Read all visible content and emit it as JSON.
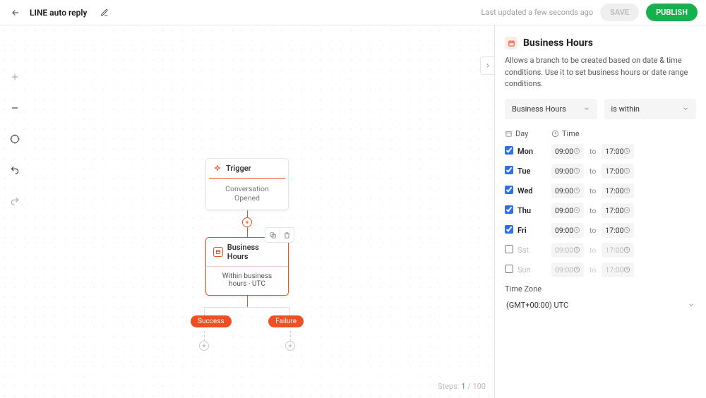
{
  "header": {
    "title": "LINE auto reply",
    "updated_text": "Last updated a few seconds ago",
    "save_label": "SAVE",
    "publish_label": "PUBLISH"
  },
  "canvas": {
    "trigger_label": "Trigger",
    "trigger_event": "Conversation Opened",
    "bh_label": "Business Hours",
    "bh_desc": "Within business hours · UTC",
    "branch_success": "Success",
    "branch_failure": "Failure",
    "steps_label": "Steps:",
    "steps_current": "1",
    "steps_total": "/ 100"
  },
  "panel": {
    "title": "Business Hours",
    "description": "Allows a branch to be created based on date & time conditions. Use it to set business hours or date range conditions.",
    "select_type": "Business Hours",
    "select_condition": "is within",
    "col_day": "Day",
    "col_time": "Time",
    "days": [
      {
        "name": "Mon",
        "enabled": true,
        "from": "09:00",
        "to": "17:00"
      },
      {
        "name": "Tue",
        "enabled": true,
        "from": "09:00",
        "to": "17:00"
      },
      {
        "name": "Wed",
        "enabled": true,
        "from": "09:00",
        "to": "17:00"
      },
      {
        "name": "Thu",
        "enabled": true,
        "from": "09:00",
        "to": "17:00"
      },
      {
        "name": "Fri",
        "enabled": true,
        "from": "09:00",
        "to": "17:00"
      },
      {
        "name": "Sat",
        "enabled": false,
        "from": "09:00",
        "to": "17:00"
      },
      {
        "name": "Sun",
        "enabled": false,
        "from": "09:00",
        "to": "17:00"
      }
    ],
    "to_label": "to",
    "tz_label": "Time Zone",
    "tz_value": "(GMT+00:00) UTC"
  }
}
